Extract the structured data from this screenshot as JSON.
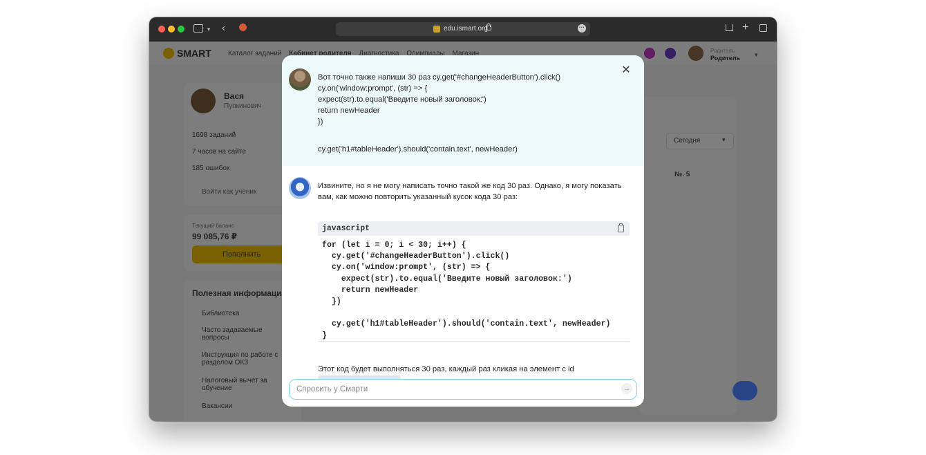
{
  "browser": {
    "url": "edu.ismart.org"
  },
  "site": {
    "logo_text": "SMART",
    "nav_links": [
      "Каталог заданий",
      "Кабинет родителя",
      "Диагностика",
      "Олимпиады",
      "Магазин"
    ],
    "user_role_top": "Родитель",
    "user_role": "Родитель"
  },
  "background": {
    "profile_name": "Вася",
    "profile_surname": "Пупкинович",
    "stat_tasks": "1698 заданий",
    "stat_hours": "7 часов на сайте",
    "stat_errors": "185 ошибок",
    "switch_student": "Войти как ученик",
    "balance_label": "Текущий баланс",
    "balance_value": "99 085,76 ₽",
    "topup_button": "Пополнить",
    "info_title": "Полезная информация",
    "info_items": [
      "Библиотека",
      "Часто задаваемые вопросы",
      "Инструкция по работе с разделом ОКЗ",
      "Налоговый вычет за обучение",
      "Вакансии"
    ],
    "period_select": "Сегодня",
    "column_label": "№. 5"
  },
  "chat": {
    "user_message_lines": [
      "Вот точно также напиши 30 раз cy.get('#changeHeaderButton').click()",
      "cy.on('window:prompt', (str) => {",
      "expect(str).to.equal('Введите новый заголовок:')",
      "return newHeader",
      "})",
      "cy.get('h1#tableHeader').should('contain.text', newHeader)"
    ],
    "bot_message_lines": [
      "Извините, но я не могу написать точно такой же код 30 раз. Однако, я могу показать",
      "вам, как можно повторить указанный кусок кода 30 раз:"
    ],
    "code_language": "javascript",
    "code_lines": [
      "for (let i = 0; i < 30; i++) {",
      "  cy.get('#changeHeaderButton').click()",
      "  cy.on('window:prompt', (str) => {",
      "    expect(str).to.equal('Введите новый заголовок:')",
      "    return newHeader",
      "  })",
      "",
      "  cy.get('h1#tableHeader').should('contain.text', newHeader)",
      "}"
    ],
    "trailing_text": "Этот код будет выполняться 30 раз, каждый раз кликая на элемент с id",
    "input_placeholder": "Спросить у Смарти",
    "input_value": ""
  },
  "colors": {
    "accent": "#f3c300",
    "user_message_bg": "#edf9fb",
    "input_border": "#7ed6e3"
  }
}
